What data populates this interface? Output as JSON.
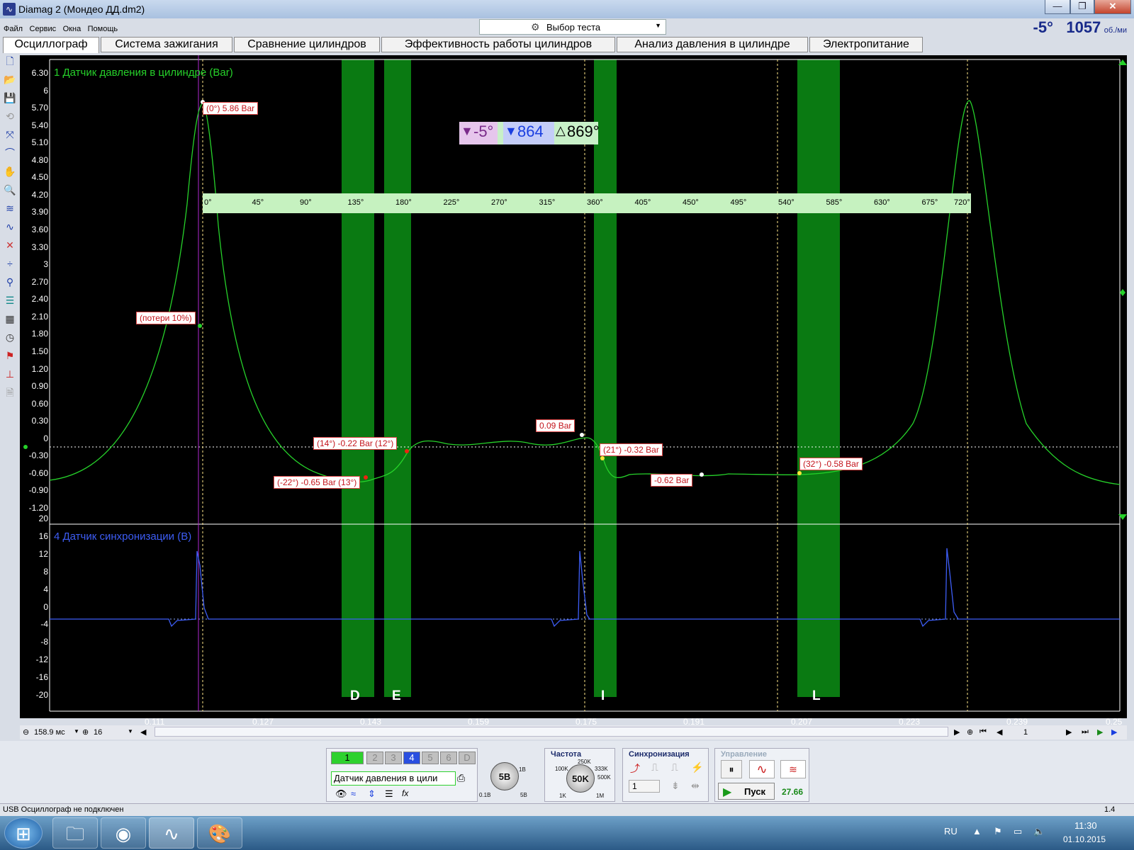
{
  "window": {
    "title": "Diamag 2 (Мондео ДД.dm2)",
    "minimize": "—",
    "maximize": "❐",
    "close": "✕"
  },
  "menu": [
    "Файл",
    "Сервис",
    "Окна",
    "Помощь"
  ],
  "test_select": {
    "label": "Выбор теста"
  },
  "readout": {
    "angle": "-5°",
    "rpm": "1057",
    "rpm_unit": "об./ми"
  },
  "tabs": [
    "Осциллограф",
    "Система зажигания",
    "Сравнение цилиндров",
    "Эффективность работы цилиндров",
    "Анализ давления в цилиндре",
    "Электропитание"
  ],
  "channel1": {
    "label": "1 Датчик давления в цилиндре (Bar)",
    "y_ticks": [
      "6.30",
      "6",
      "5.70",
      "5.40",
      "5.10",
      "4.80",
      "4.50",
      "4.20",
      "3.90",
      "3.60",
      "3.30",
      "3",
      "2.70",
      "2.40",
      "2.10",
      "1.80",
      "1.50",
      "1.20",
      "0.90",
      "0.60",
      "0.30",
      "0",
      "-0.30",
      "-0.60",
      "-0.90",
      "-1.20"
    ],
    "color": "#26d12a"
  },
  "channel4": {
    "label": "4 Датчик синхронизации (В)",
    "y_ticks": [
      "20",
      "16",
      "12",
      "8",
      "4",
      "0",
      "-4",
      "-8",
      "-12",
      "-16",
      "-20"
    ],
    "color": "#3d5df5"
  },
  "x_ticks": [
    "0.111",
    "0.127",
    "0.143",
    "0.159",
    "0.175",
    "0.191",
    "0.207",
    "0.223",
    "0.239",
    "0.25"
  ],
  "angle_box": {
    "marker1": "-5°",
    "marker2": "864",
    "delta": "869°"
  },
  "ruler_ticks": [
    "0°",
    "45°",
    "90°",
    "135°",
    "180°",
    "225°",
    "270°",
    "315°",
    "360°",
    "405°",
    "450°",
    "495°",
    "540°",
    "585°",
    "630°",
    "675°",
    "720°"
  ],
  "annotations": {
    "peak": "(0°) 5.86 Bar",
    "losses": "(потери 10%)",
    "p14": "(14°) -0.22 Bar (12°)",
    "p22": "(-22°) -0.65 Bar (13°)",
    "p009": "0.09 Bar",
    "p21": "(21°) -0.32 Bar",
    "p062": "-0.62 Bar",
    "p32": "(32°) -0.58 Bar"
  },
  "zones": [
    "D",
    "E",
    "I",
    "L"
  ],
  "scroll_row": {
    "time_per_div": "158.9 мс",
    "count": "16",
    "page": "1"
  },
  "bottom": {
    "channel_buttons": [
      "1",
      "2",
      "3",
      "4",
      "5",
      "6",
      "D"
    ],
    "channel_select": "Датчик давления в цили",
    "volt_knob": "5В",
    "volt_min": "0.1В",
    "volt_max": "1В",
    "volt_5": "5В",
    "freq_title": "Частота",
    "freq_knob": "50K",
    "freq_scale": [
      "100K",
      "250K",
      "333K",
      "500K",
      "1K",
      "1M"
    ],
    "sync_title": "Синхронизация",
    "sync_value": "1",
    "control_title": "Управление",
    "start_label": "Пуск",
    "fps": "27.66"
  },
  "status": {
    "left": "USB Осциллограф не подключен",
    "right": "1.4"
  },
  "taskbar": {
    "lang": "RU",
    "time": "11:30",
    "date": "01.10.2015"
  }
}
